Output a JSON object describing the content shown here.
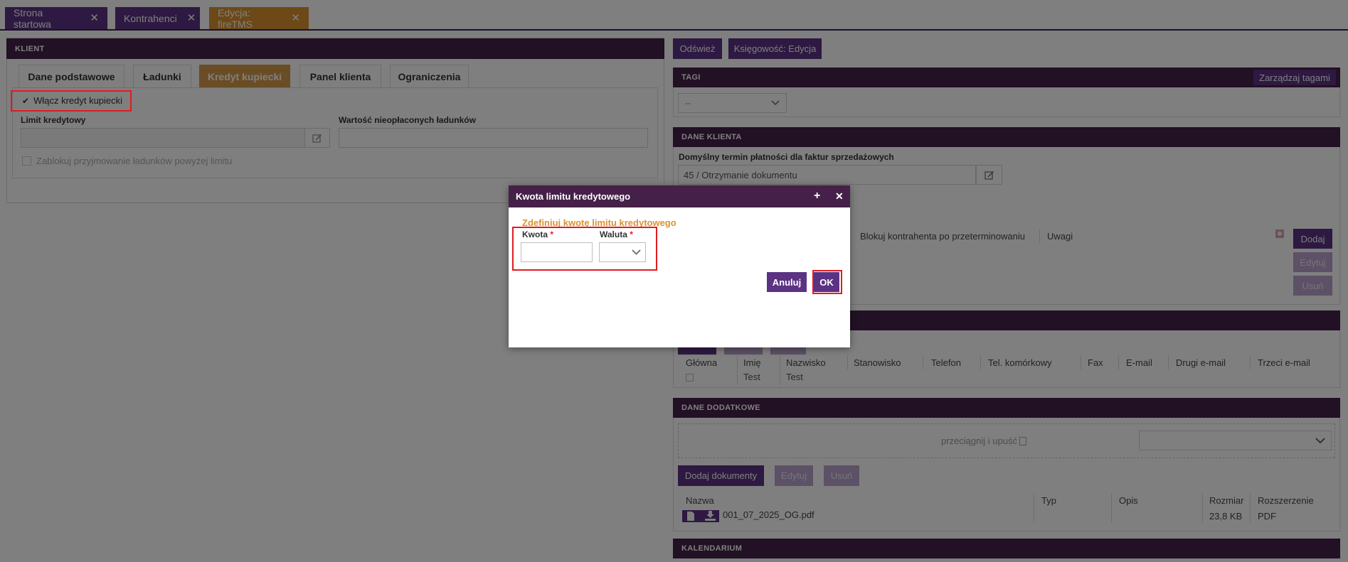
{
  "tabs": [
    {
      "label": "Strona startowa"
    },
    {
      "label": "Kontrahenci"
    },
    {
      "label": "Edycja: fireTMS"
    }
  ],
  "client": {
    "header": "KLIENT",
    "subtabs": [
      "Dane podstawowe",
      "Ładunki",
      "Kredyt kupiecki",
      "Panel klienta",
      "Ograniczenia"
    ],
    "enable_credit_label": "Włącz kredyt kupiecki",
    "limit_label": "Limit kredytowy",
    "unpaid_label": "Wartość nieopłaconych ładunków",
    "block_label": "Zablokuj przyjmowanie ładunków powyżej limitu"
  },
  "right": {
    "refresh_button": "Odśwież",
    "accounting_button": "Księgowość: Edycja",
    "tags_header": "TAGI",
    "manage_tags_button": "Zarządzaj tagami",
    "tags_select_value": "--",
    "client_data_header": "DANE KLIENTA",
    "payment_term_label": "Domyślny termin płatności dla faktur sprzedażowych",
    "payment_term_value": "45 / Otrzymanie dokumentu",
    "block_overdue_col": "Blokuj kontrahenta po przeterminowaniu",
    "notes_col": "Uwagi",
    "add_button": "Dodaj",
    "edit_button": "Edytuj",
    "delete_button": "Usuń",
    "contacts": {
      "columns": [
        "Główna",
        "Imię",
        "Nazwisko",
        "Stanowisko",
        "Telefon",
        "Tel. komórkowy",
        "Fax",
        "E-mail",
        "Drugi e-mail",
        "Trzeci e-mail"
      ],
      "row": {
        "first_name": "Test",
        "last_name": "Test"
      }
    },
    "extra_header": "DANE DODATKOWE",
    "dropzone_text": "przeciągnij i upuść ",
    "add_docs_button": "Dodaj dokumenty",
    "docs_edit_button": "Edytuj",
    "docs_delete_button": "Usuń",
    "docs": {
      "columns": [
        "Nazwa",
        "Typ",
        "Opis",
        "Rozmiar",
        "Rozszerzenie"
      ],
      "file": {
        "name": "001_07_2025_OG.pdf",
        "size": "23,8 KB",
        "ext": "PDF"
      }
    },
    "calendar_header": "KALENDARIUM"
  },
  "modal": {
    "title": "Kwota limitu kredytowego",
    "subtitle": "Zdefiniuj kwotę limitu kredytowego",
    "amount_label": "Kwota",
    "currency_label": "Waluta",
    "required_mark": "*",
    "cancel_button": "Anuluj",
    "ok_button": "OK"
  },
  "colors": {
    "purple": "#5b3382",
    "dark_purple": "#452048",
    "orange": "#d9922e",
    "highlight_red": "#e11b22"
  },
  "icons": [
    "close-icon",
    "check-icon",
    "edit-icon",
    "chevron-down-icon",
    "plus-icon",
    "file-icon",
    "download-icon",
    "pin-icon"
  ]
}
